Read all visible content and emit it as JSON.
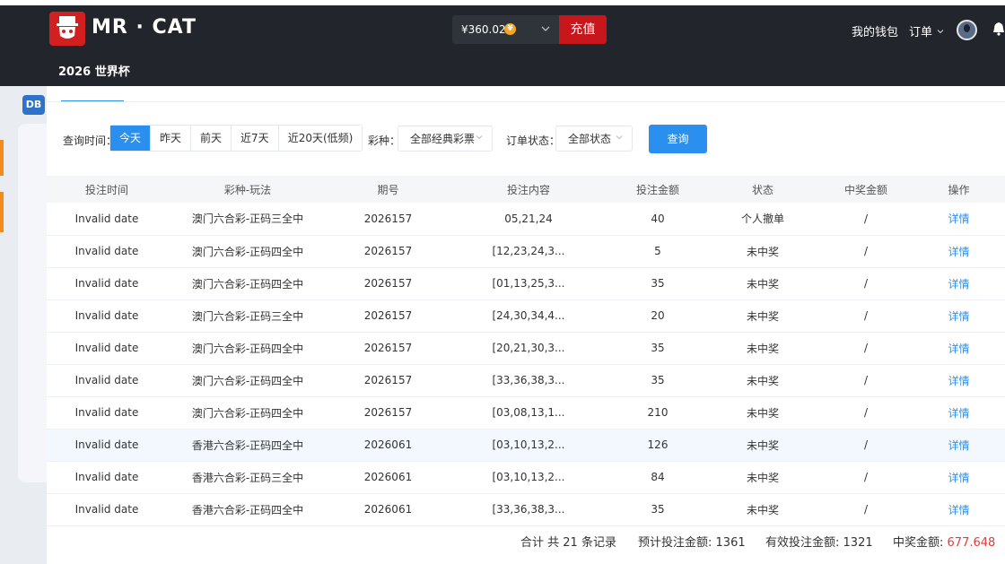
{
  "header": {
    "brand": "MR · CAT",
    "subtitle": "2026 世界杯",
    "balance": "¥360.02",
    "coin_symbol": "¥",
    "recharge_label": "充值",
    "wallet_label": "我的钱包",
    "orders_label": "订单",
    "icons": [
      "cat-logo-icon",
      "coin-icon",
      "chevron-down-icon",
      "avatar",
      "bell-icon"
    ]
  },
  "background": {
    "db_label": "DB"
  },
  "filters": {
    "time_label": "查询时间：",
    "time_options": [
      "今天",
      "昨天",
      "前天",
      "近7天",
      "近20天(低频)"
    ],
    "time_selected": "今天",
    "lottery_label": "彩种：",
    "lottery_value": "全部经典彩票",
    "status_label": "订单状态：",
    "status_value": "全部状态",
    "query_label": "查询"
  },
  "table": {
    "columns": [
      "投注时间",
      "彩种-玩法",
      "期号",
      "投注内容",
      "投注金额",
      "状态",
      "中奖金额",
      "操作"
    ],
    "rows": [
      {
        "time": "Invalid date",
        "game": "澳门六合彩-正码三全中",
        "issue": "2026157",
        "content": "05,21,24",
        "amount": "40",
        "status": "个人撤单",
        "win": "/",
        "action": "详情"
      },
      {
        "time": "Invalid date",
        "game": "澳门六合彩-正码四全中",
        "issue": "2026157",
        "content": "[12,23,24,3...",
        "amount": "5",
        "status": "未中奖",
        "win": "/",
        "action": "详情"
      },
      {
        "time": "Invalid date",
        "game": "澳门六合彩-正码四全中",
        "issue": "2026157",
        "content": "[01,13,25,3...",
        "amount": "35",
        "status": "未中奖",
        "win": "/",
        "action": "详情"
      },
      {
        "time": "Invalid date",
        "game": "澳门六合彩-正码三全中",
        "issue": "2026157",
        "content": "[24,30,34,4...",
        "amount": "20",
        "status": "未中奖",
        "win": "/",
        "action": "详情"
      },
      {
        "time": "Invalid date",
        "game": "澳门六合彩-正码四全中",
        "issue": "2026157",
        "content": "[20,21,30,3...",
        "amount": "35",
        "status": "未中奖",
        "win": "/",
        "action": "详情"
      },
      {
        "time": "Invalid date",
        "game": "澳门六合彩-正码四全中",
        "issue": "2026157",
        "content": "[33,36,38,3...",
        "amount": "35",
        "status": "未中奖",
        "win": "/",
        "action": "详情"
      },
      {
        "time": "Invalid date",
        "game": "澳门六合彩-正码四全中",
        "issue": "2026157",
        "content": "[03,08,13,1...",
        "amount": "210",
        "status": "未中奖",
        "win": "/",
        "action": "详情"
      },
      {
        "time": "Invalid date",
        "game": "香港六合彩-正码四全中",
        "issue": "2026061",
        "content": "[03,10,13,2...",
        "amount": "126",
        "status": "未中奖",
        "win": "/",
        "action": "详情"
      },
      {
        "time": "Invalid date",
        "game": "香港六合彩-正码三全中",
        "issue": "2026061",
        "content": "[03,10,13,2...",
        "amount": "84",
        "status": "未中奖",
        "win": "/",
        "action": "详情"
      },
      {
        "time": "Invalid date",
        "game": "香港六合彩-正码四全中",
        "issue": "2026061",
        "content": "[33,36,38,3...",
        "amount": "35",
        "status": "未中奖",
        "win": "/",
        "action": "详情"
      }
    ],
    "highlight_row": 7
  },
  "summary": {
    "total_records": "合计 共 21 条记录",
    "expected_label": "预计投注金额:",
    "expected_value": "1361",
    "valid_label": "有效投注金额:",
    "valid_value": "1321",
    "win_label": "中奖金额:",
    "win_value": "677.648"
  }
}
